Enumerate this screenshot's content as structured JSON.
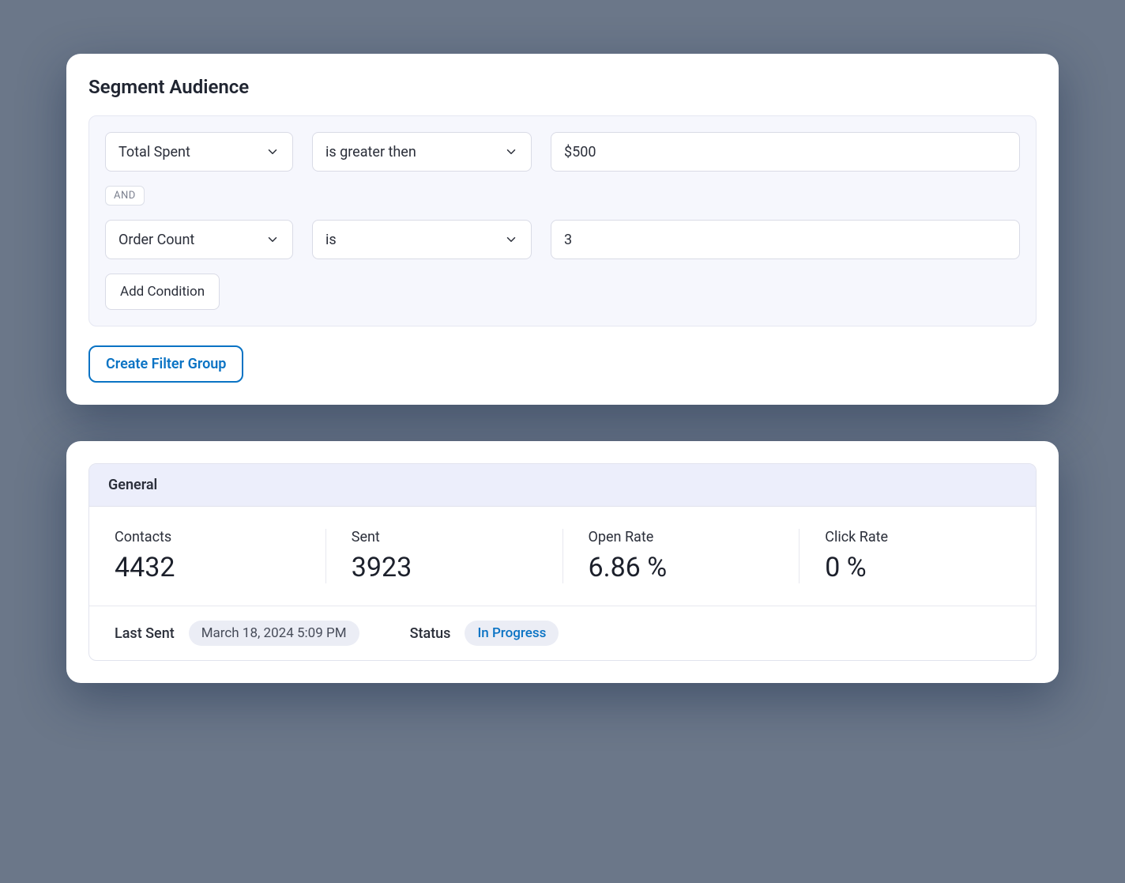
{
  "segment": {
    "title": "Segment Audience",
    "conditions": [
      {
        "field": "Total Spent",
        "operator": "is greater then",
        "value": "$500"
      },
      {
        "field": "Order Count",
        "operator": "is",
        "value": "3"
      }
    ],
    "joiner": "AND",
    "add_condition_label": "Add Condition",
    "create_group_label": "Create Filter Group"
  },
  "general": {
    "header": "General",
    "stats": {
      "contacts": {
        "label": "Contacts",
        "value": "4432"
      },
      "sent": {
        "label": "Sent",
        "value": "3923"
      },
      "open_rate": {
        "label": "Open Rate",
        "value": "6.86 %"
      },
      "click_rate": {
        "label": "Click Rate",
        "value": "0 %"
      }
    },
    "last_sent": {
      "label": "Last Sent",
      "value": "March 18, 2024 5:09 PM"
    },
    "status": {
      "label": "Status",
      "value": "In Progress"
    }
  }
}
